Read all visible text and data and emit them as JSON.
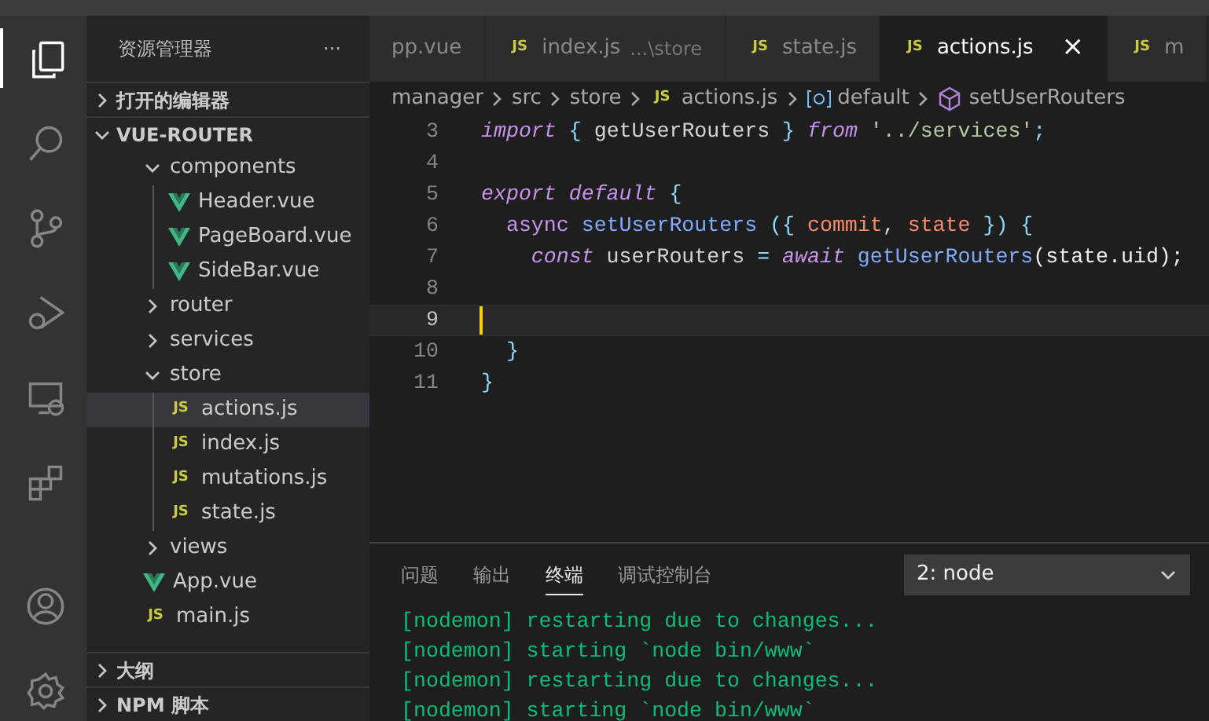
{
  "activity_bar": [
    {
      "kind": "files",
      "selected": true
    },
    {
      "kind": "search",
      "selected": false
    },
    {
      "kind": "source-control",
      "selected": false
    },
    {
      "kind": "debug",
      "selected": false
    },
    {
      "kind": "remote",
      "selected": false
    },
    {
      "kind": "extensions",
      "selected": false
    },
    {
      "kind": "account",
      "selected": false
    },
    {
      "kind": "settings",
      "selected": false
    }
  ],
  "sidebar": {
    "title": "资源管理器",
    "more": "···",
    "sections_top": [
      {
        "label": "打开的编辑器",
        "expanded": false
      },
      {
        "label": "VUE-ROUTER",
        "expanded": true
      }
    ],
    "tree": [
      {
        "name": "components",
        "kind": "folder",
        "expanded": true,
        "selected": false,
        "children": [
          {
            "name": "Header.vue",
            "kind": "vue",
            "selected": false
          },
          {
            "name": "PageBoard.vue",
            "kind": "vue",
            "selected": false
          },
          {
            "name": "SideBar.vue",
            "kind": "vue",
            "selected": false
          }
        ]
      },
      {
        "name": "router",
        "kind": "folder",
        "expanded": false,
        "selected": false
      },
      {
        "name": "services",
        "kind": "folder",
        "expanded": false,
        "selected": false
      },
      {
        "name": "store",
        "kind": "folder",
        "expanded": true,
        "selected": false,
        "children": [
          {
            "name": "actions.js",
            "kind": "js",
            "icon_label": "JS",
            "selected": true
          },
          {
            "name": "index.js",
            "kind": "js",
            "icon_label": "JS",
            "selected": false
          },
          {
            "name": "mutations.js",
            "kind": "js",
            "icon_label": "JS",
            "selected": false
          },
          {
            "name": "state.js",
            "kind": "js",
            "icon_label": "JS",
            "selected": false
          }
        ]
      },
      {
        "name": "views",
        "kind": "folder",
        "expanded": false,
        "selected": false
      },
      {
        "name": "App.vue",
        "kind": "vue",
        "selected": false
      },
      {
        "name": "main.js",
        "kind": "js",
        "icon_label": "JS",
        "selected": false
      }
    ],
    "sections_bottom": [
      {
        "label": "大纲",
        "expanded": false
      },
      {
        "label": "NPM 脚本",
        "expanded": false
      }
    ]
  },
  "tabs": [
    {
      "label": "pp.vue",
      "selected": false
    },
    {
      "label": "index.js",
      "kind": "js",
      "icon_label": "JS",
      "description": "...\\store",
      "selected": false
    },
    {
      "label": "state.js",
      "kind": "js",
      "icon_label": "JS",
      "selected": false
    },
    {
      "label": "actions.js",
      "kind": "js",
      "icon_label": "JS",
      "selected": true,
      "close": "×"
    },
    {
      "label": "m",
      "kind": "js",
      "icon_label": "JS",
      "selected": false
    }
  ],
  "breadcrumb": [
    {
      "label": "manager"
    },
    {
      "label": "src"
    },
    {
      "label": "store"
    },
    {
      "label": "actions.js",
      "kind": "js",
      "icon_label": "JS"
    },
    {
      "label": "default",
      "kind": "variable"
    },
    {
      "label": "setUserRouters",
      "kind": "method"
    }
  ],
  "code": [
    {
      "number": "3",
      "current": false,
      "tokens": [
        {
          "text": "import",
          "kind": "keyword"
        },
        {
          "text": " { ",
          "kind": "brace"
        },
        {
          "text": "getUserRouters",
          "kind": "plain"
        },
        {
          "text": " } ",
          "kind": "brace"
        },
        {
          "text": "from",
          "kind": "keyword"
        },
        {
          "text": " '../services'",
          "kind": "string"
        },
        {
          "text": ";",
          "kind": "brace"
        }
      ]
    },
    {
      "number": "4",
      "current": false
    },
    {
      "number": "5",
      "current": false,
      "tokens": [
        {
          "text": "export default",
          "kind": "keyword"
        },
        {
          "text": " {",
          "kind": "brace"
        }
      ]
    },
    {
      "number": "6",
      "current": false,
      "tokens": [
        {
          "text": "  async ",
          "kind": "storage"
        },
        {
          "text": "setUserRouters",
          "kind": "function"
        },
        {
          "text": " ({ ",
          "kind": "brace"
        },
        {
          "text": "commit",
          "kind": "param"
        },
        {
          "text": ", ",
          "kind": "plain"
        },
        {
          "text": "state",
          "kind": "param"
        },
        {
          "text": " }) {",
          "kind": "brace"
        }
      ]
    },
    {
      "number": "7",
      "current": false,
      "tokens": [
        {
          "text": "    const",
          "kind": "keyword"
        },
        {
          "text": " userRouters ",
          "kind": "plain"
        },
        {
          "text": "=",
          "kind": "brace"
        },
        {
          "text": " await",
          "kind": "keyword"
        },
        {
          "text": " getUserRouters",
          "kind": "function"
        },
        {
          "text": "(state.uid);",
          "kind": "white"
        }
      ]
    },
    {
      "number": "8",
      "current": false
    },
    {
      "number": "9",
      "current": true
    },
    {
      "number": "10",
      "current": false,
      "tokens": [
        {
          "text": "  }",
          "kind": "brace"
        }
      ]
    },
    {
      "number": "11",
      "current": false,
      "tokens": [
        {
          "text": "}",
          "kind": "brace"
        }
      ]
    }
  ],
  "panel": {
    "tabs": [
      {
        "label": "问题",
        "selected": false
      },
      {
        "label": "输出",
        "selected": false
      },
      {
        "label": "终端",
        "selected": true
      },
      {
        "label": "调试控制台",
        "selected": false
      }
    ],
    "terminal_select": "2: node",
    "terminal_lines": [
      "[nodemon] restarting due to changes...",
      "[nodemon] starting `node bin/www`",
      "[nodemon] restarting due to changes...",
      "[nodemon] starting `node bin/www`"
    ]
  }
}
